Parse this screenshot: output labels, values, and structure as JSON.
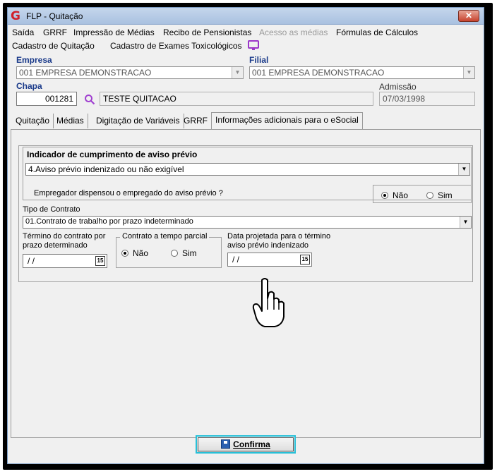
{
  "window": {
    "title": "FLP - Quitação",
    "close_glyph": "✕"
  },
  "menu": {
    "row1": [
      "Saída",
      "GRRF",
      "Impressão de Médias",
      "Recibo de Pensionistas",
      "Acesso as médias",
      "Fórmulas de Cálculos"
    ],
    "row2": [
      "Cadastro de Quitação",
      "Cadastro de Exames Toxicológicos"
    ]
  },
  "empresa": {
    "label": "Empresa",
    "value": "001 EMPRESA DEMONSTRACAO"
  },
  "filial": {
    "label": "Filial",
    "value": "001 EMPRESA DEMONSTRACAO"
  },
  "chapa": {
    "label": "Chapa",
    "value": "001281",
    "name": "TESTE QUITACAO"
  },
  "admissao": {
    "label": "Admissão",
    "value": "07/03/1998"
  },
  "tabs": [
    "Quitação",
    "Médias",
    "Digitação de Variáveis",
    "GRRF",
    "Informações adicionais para o eSocial"
  ],
  "aviso": {
    "title": "Indicador de cumprimento de aviso prévio",
    "value": "4.Aviso prévio indenizado ou não exigível",
    "question": "Empregador dispensou o empregado do aviso prévio ?",
    "opt_nao": "Não",
    "opt_sim": "Sim"
  },
  "contrato": {
    "label": "Tipo de Contrato",
    "value": "01.Contrato de trabalho por prazo indeterminado"
  },
  "termino": {
    "label1": "Término do contrato por",
    "label2": "prazo determinado",
    "value": "/ /"
  },
  "parcial": {
    "title": "Contrato a tempo parcial",
    "opt_nao": "Não",
    "opt_sim": "Sim"
  },
  "projetada": {
    "label1": "Data projetada para o término",
    "label2": "aviso prévio indenizado",
    "value": "/ /"
  },
  "calendar_glyph": "15",
  "confirm_label": "Confirma",
  "colors": {
    "accent": "#27c0d8",
    "label_blue": "#1a3a8a",
    "logo_red": "#d1202a"
  },
  "icons": [
    "app-logo-icon",
    "close-icon",
    "search-icon",
    "monitor-icon",
    "calendar-icon",
    "save-icon",
    "hand-cursor-icon"
  ]
}
